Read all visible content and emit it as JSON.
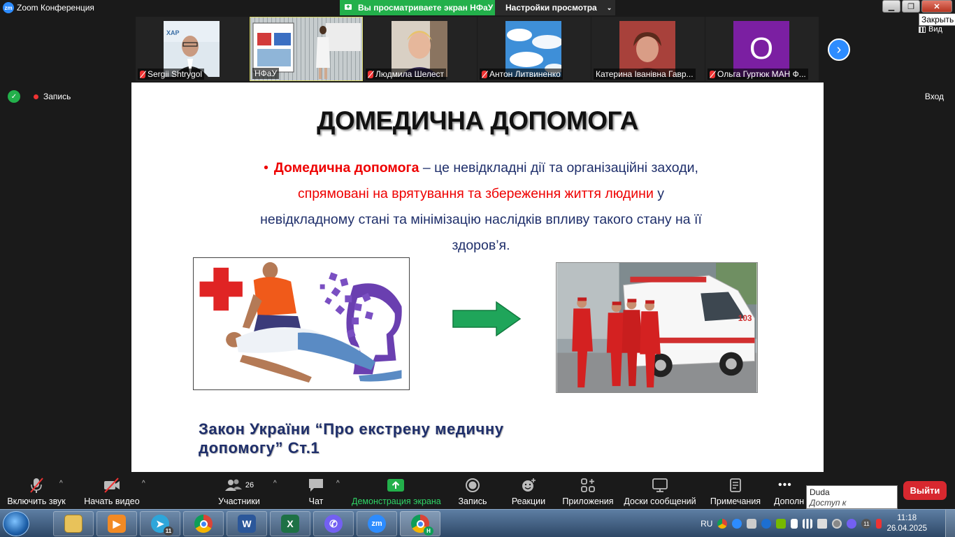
{
  "window": {
    "title": "Zoom Конференция",
    "share_banner": "Вы просматриваете экран НФаУ",
    "view_options": "Настройки просмотра",
    "close_tooltip": "Закрыть",
    "view_button": "Вид"
  },
  "participants": [
    {
      "name": "Sergii Shtrygol",
      "muted": true
    },
    {
      "name": "НФаУ",
      "muted": false,
      "active": true
    },
    {
      "name": "Людмила Шелест",
      "muted": true
    },
    {
      "name": "Антон Литвиненко",
      "muted": true
    },
    {
      "name": "Катерина Іванівна Гавр...",
      "muted": false
    },
    {
      "name": "Ольга Гуртюк МАН Ф...",
      "muted": true,
      "avatar_letter": "О"
    }
  ],
  "status": {
    "recording": "Запись",
    "login": "Вход"
  },
  "slide": {
    "title": "ДОМЕДИЧНА ДОПОМОГА",
    "bullet": "•",
    "term": "Домедична допомога",
    "def_part1": " – це невідкладні дії та організаційні заходи, ",
    "def_red": "спрямовані на врятування та збереження життя людини",
    "def_part2": " у невідкладному стані та мінімізацію наслідків впливу такого стану на її здоров’я.",
    "ambulance_text": "103",
    "law": "Закон України “Про екстрену медичну допомогу” Ст.1"
  },
  "controls": {
    "mute": "Включить звук",
    "video": "Начать видео",
    "participants": "Участники",
    "participants_count": "26",
    "chat": "Чат",
    "share": "Демонстрация экрана",
    "record": "Запись",
    "reactions": "Реакции",
    "apps": "Приложения",
    "whiteboards": "Доски сообщений",
    "notes": "Примечания",
    "more": "Дополн",
    "leave": "Выйти"
  },
  "notification": {
    "network": "Duda",
    "status": "Доступ к Интернету"
  },
  "taskbar": {
    "lang": "RU",
    "time": "11:18",
    "date": "26.04.2025",
    "telegram_badge": "11",
    "chrome_badge": "H",
    "viber_badge": "11"
  },
  "colors": {
    "zoom_blue": "#2d8cff",
    "share_green": "#23b04b",
    "leave_red": "#d7282f",
    "slide_red": "#e00000",
    "slide_navy": "#1f2f6b"
  }
}
